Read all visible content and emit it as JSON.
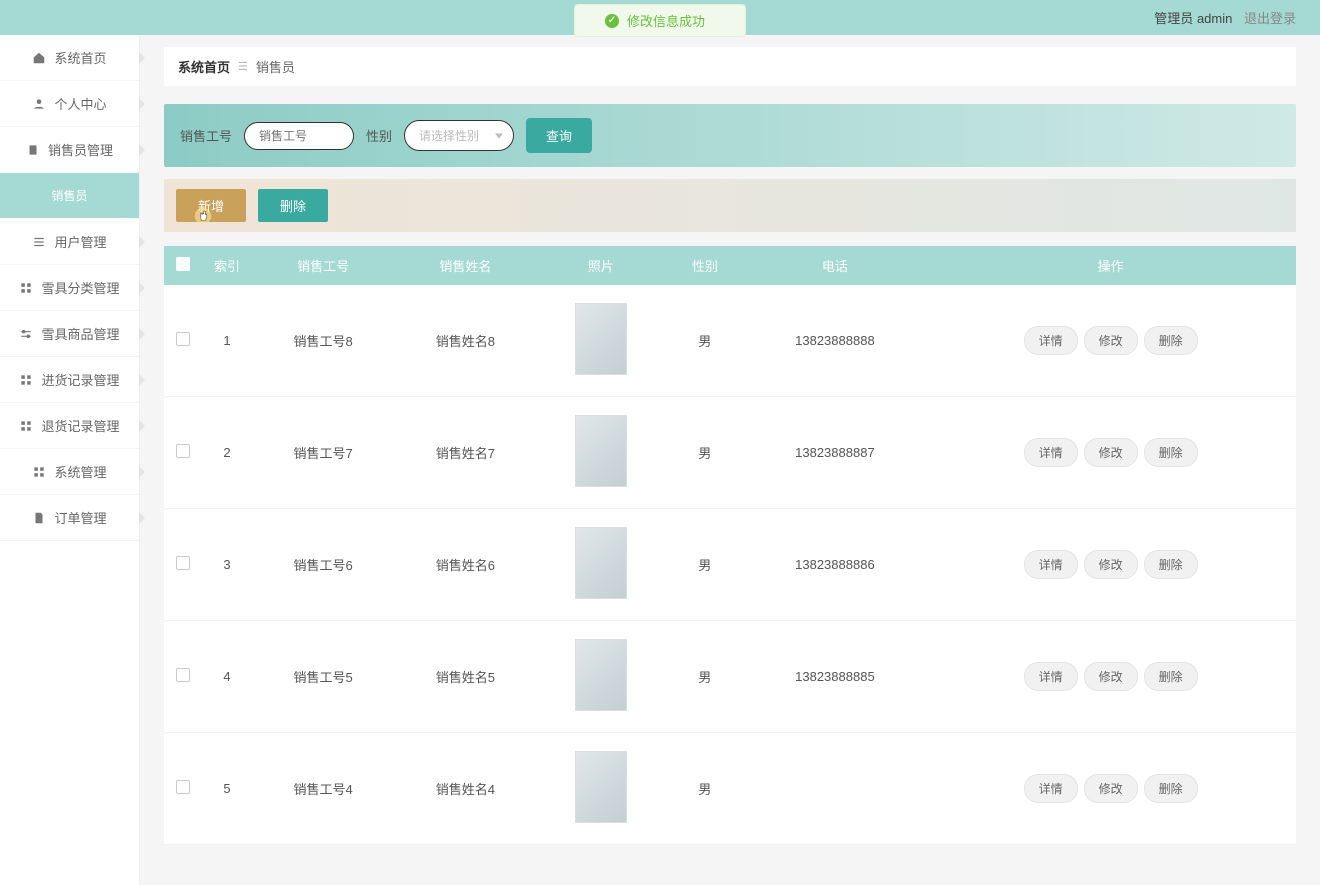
{
  "toast": {
    "message": "修改信息成功"
  },
  "top": {
    "role": "管理员",
    "user": "admin",
    "logout": "退出登录"
  },
  "sidebar": {
    "items": [
      {
        "label": "系统首页",
        "icon": "home"
      },
      {
        "label": "个人中心",
        "icon": "user"
      },
      {
        "label": "销售员管理",
        "icon": "clipboard"
      },
      {
        "label": "销售员",
        "sub": true
      },
      {
        "label": "用户管理",
        "icon": "menu"
      },
      {
        "label": "雪具分类管理",
        "icon": "grid"
      },
      {
        "label": "雪具商品管理",
        "icon": "sliders"
      },
      {
        "label": "进货记录管理",
        "icon": "grid"
      },
      {
        "label": "退货记录管理",
        "icon": "grid"
      },
      {
        "label": "系统管理",
        "icon": "grid"
      },
      {
        "label": "订单管理",
        "icon": "doc"
      }
    ]
  },
  "breadcrumb": {
    "home": "系统首页",
    "current": "销售员"
  },
  "filter": {
    "label_id": "销售工号",
    "placeholder_id": "销售工号",
    "label_gender": "性别",
    "placeholder_gender": "请选择性别",
    "query": "查询"
  },
  "actions": {
    "add": "新增",
    "delete": "删除"
  },
  "table": {
    "headers": {
      "index": "索引",
      "id": "销售工号",
      "name": "销售姓名",
      "photo": "照片",
      "gender": "性别",
      "phone": "电话",
      "ops": "操作"
    },
    "btns": {
      "detail": "详情",
      "edit": "修改",
      "delete": "删除"
    },
    "rows": [
      {
        "index": "1",
        "id": "销售工号8",
        "name": "销售姓名8",
        "gender": "男",
        "phone": "13823888888"
      },
      {
        "index": "2",
        "id": "销售工号7",
        "name": "销售姓名7",
        "gender": "男",
        "phone": "13823888887"
      },
      {
        "index": "3",
        "id": "销售工号6",
        "name": "销售姓名6",
        "gender": "男",
        "phone": "13823888886"
      },
      {
        "index": "4",
        "id": "销售工号5",
        "name": "销售姓名5",
        "gender": "男",
        "phone": "13823888885"
      },
      {
        "index": "5",
        "id": "销售工号4",
        "name": "销售姓名4",
        "gender": "男",
        "phone": ""
      }
    ]
  }
}
